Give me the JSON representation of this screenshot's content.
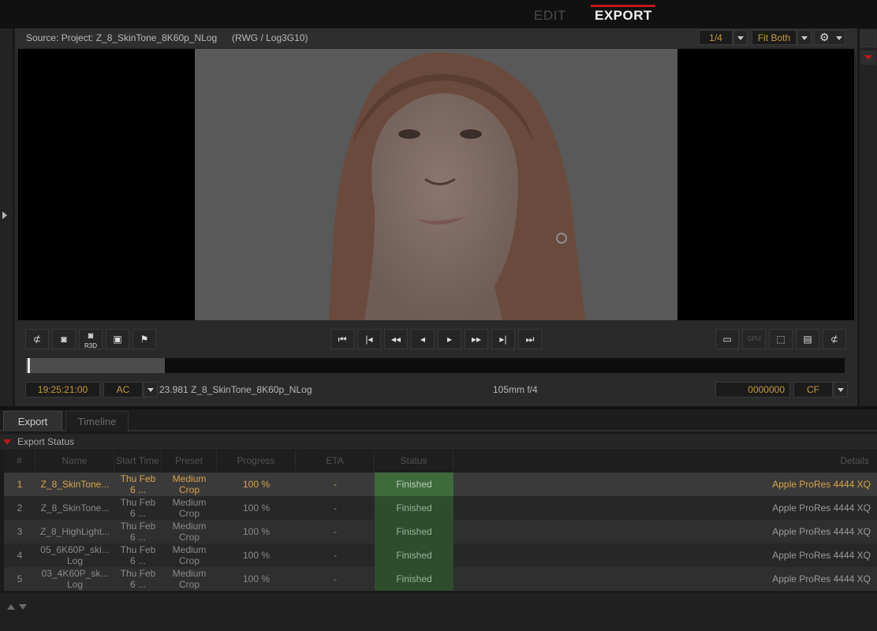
{
  "modes": {
    "edit": "EDIT",
    "export": "EXPORT",
    "active": "export"
  },
  "viewer": {
    "source_label": "Source: Project: Z_8_SkinTone_8K60p_NLog",
    "colorspace": "(RWG / Log3G10)",
    "resolution": "1/4",
    "fit_mode": "Fit Both",
    "timecode": "19:25:21:00",
    "timecode_mode": "AC",
    "clip_info": "23.981 Z_8_SkinTone_8K60p_NLog",
    "lens_info": "105mm f/4",
    "frame_counter": "0000000",
    "frame_mode": "CF",
    "playback_position": 0.17
  },
  "toolbar_left": [
    "no-overlay-icon",
    "snapshot-icon",
    "r3d-snapshot-icon",
    "preview-icon",
    "flag-icon"
  ],
  "toolbar_left_r3d_label": "R3D",
  "transport": [
    "go-to-start-icon",
    "previous-frame-icon",
    "rewind-icon",
    "step-back-icon",
    "play-icon",
    "fast-forward-icon",
    "next-frame-icon",
    "go-to-end-icon"
  ],
  "toolbar_right": [
    "monitor-icon",
    "gpu-icon",
    "safe-area-icon",
    "film-strip-icon",
    "no-overlay-icon"
  ],
  "gpu_label": "GPU",
  "bottom_tabs": {
    "export": "Export",
    "timeline": "Timeline"
  },
  "export_status": {
    "title": "Export Status",
    "columns": {
      "num": "#",
      "name": "Name",
      "start_time": "Start Time",
      "preset": "Preset",
      "progress": "Progress",
      "eta": "ETA",
      "status": "Status",
      "details": "Details"
    },
    "rows": [
      {
        "num": "1",
        "name": "Z_8_SkinTone...",
        "start_a": "Thu Feb",
        "start_b": "6 ...",
        "preset_a": "Medium",
        "preset_b": "Crop",
        "progress": "100 %",
        "eta": "-",
        "status": "Finished",
        "details": "Apple ProRes 4444 XQ"
      },
      {
        "num": "2",
        "name": "Z_8_SkinTone...",
        "start_a": "Thu Feb",
        "start_b": "6 ...",
        "preset_a": "Medium",
        "preset_b": "Crop",
        "progress": "100 %",
        "eta": "-",
        "status": "Finished",
        "details": "Apple ProRes 4444 XQ"
      },
      {
        "num": "3",
        "name": "Z_8_HighLight...",
        "start_a": "Thu Feb",
        "start_b": "6 ...",
        "preset_a": "Medium",
        "preset_b": "Crop",
        "progress": "100 %",
        "eta": "-",
        "status": "Finished",
        "details": "Apple ProRes 4444 XQ"
      },
      {
        "num": "4",
        "name_a": "05_6K60P_ski...",
        "name_b": "Log",
        "start_a": "Thu Feb",
        "start_b": "6 ...",
        "preset_a": "Medium",
        "preset_b": "Crop",
        "progress": "100 %",
        "eta": "-",
        "status": "Finished",
        "details": "Apple ProRes 4444 XQ"
      },
      {
        "num": "5",
        "name_a": "03_4K60P_sk...",
        "name_b": "Log",
        "start_a": "Thu Feb",
        "start_b": "6 ...",
        "preset_a": "Medium",
        "preset_b": "Crop",
        "progress": "100 %",
        "eta": "-",
        "status": "Finished",
        "details": "Apple ProRes 4444 XQ"
      }
    ]
  },
  "colors": {
    "accent_red": "#c0171b",
    "timecode_orange": "#c49a3d",
    "status_green": "#2d4d2d"
  }
}
